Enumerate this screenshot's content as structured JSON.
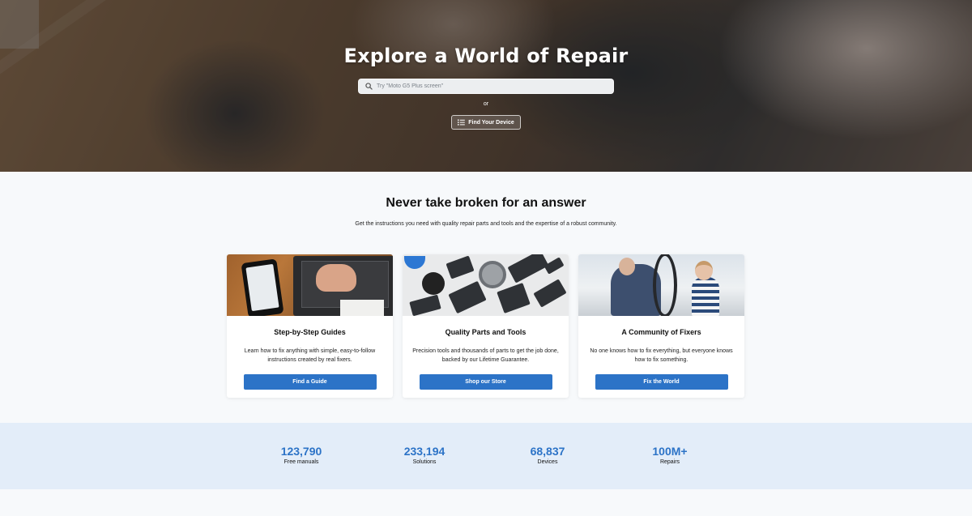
{
  "hero": {
    "title": "Explore a World of Repair",
    "search_placeholder": "Try \"Moto G5 Plus screen\"",
    "or_text": "or",
    "find_device_label": "Find Your Device"
  },
  "intro": {
    "title": "Never take broken for an answer",
    "subtitle": "Get the instructions you need with quality repair parts and tools and the expertise of a robust community."
  },
  "cards": [
    {
      "title": "Step-by-Step Guides",
      "description": "Learn how to fix anything with simple, easy-to-follow instructions created by real fixers.",
      "button": "Find a Guide"
    },
    {
      "title": "Quality Parts and Tools",
      "description": "Precision tools and thousands of parts to get the job done, backed by our Lifetime Guarantee.",
      "button": "Shop our Store"
    },
    {
      "title": "A Community of Fixers",
      "description": "No one knows how to fix everything, but everyone knows how to fix something.",
      "button": "Fix the World"
    }
  ],
  "stats": [
    {
      "value": "123,790",
      "label": "Free manuals"
    },
    {
      "value": "233,194",
      "label": "Solutions"
    },
    {
      "value": "68,837",
      "label": "Devices"
    },
    {
      "value": "100M+",
      "label": "Repairs"
    }
  ],
  "colors": {
    "accent": "#2c73c7",
    "stats_bg": "#e3edf9",
    "page_bg": "#f7f9fb"
  },
  "icons": {
    "search": "search-icon",
    "find_device": "list-icon"
  }
}
